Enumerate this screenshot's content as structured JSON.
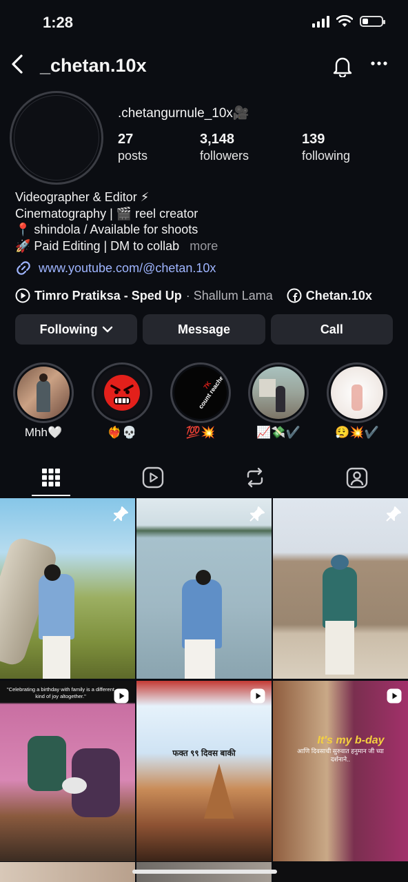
{
  "status": {
    "time": "1:28"
  },
  "header": {
    "username": "_chetan.10x"
  },
  "profile": {
    "handle": ".chetangurnule_10x🎥",
    "stats": [
      {
        "value": "27",
        "label": "posts"
      },
      {
        "value": "3,148",
        "label": "followers"
      },
      {
        "value": "139",
        "label": "following"
      }
    ],
    "bio": [
      "Videographer & Editor ⚡",
      "Cinematography | 🎬 reel creator",
      "📍 shindola / Available for shoots",
      "🚀 Paid Editing | DM to collab"
    ],
    "bio_more": "more",
    "link": "www.youtube.com/@chetan.10x",
    "music_title": "Timro Pratiksa - Sped Up",
    "music_artist": "· Shallum Lama",
    "facebook": "Chetan.10x"
  },
  "buttons": {
    "following": "Following",
    "message": "Message",
    "call": "Call"
  },
  "highlights": [
    {
      "caption": "Mhh🤍"
    },
    {
      "caption": "❤️‍🔥💀"
    },
    {
      "caption": "💯💥"
    },
    {
      "caption": "📈💸✔️"
    },
    {
      "caption": "😮‍💨💥✔️"
    }
  ],
  "highlight_texts": {
    "count_reached": "count reached",
    "seven_k": "7K"
  },
  "posts": {
    "p4_text": "\"Celebrating a birthday with family is a different kind of joy altogether.\"",
    "p5_text": "फक्त ९९ दिवस बाकी",
    "p6_title": "It's my b-day",
    "p6_text": "आणि दिवसाची सुरुवात हनुमान जी च्या दर्शनाने.."
  },
  "colors": {
    "background": "#0b0d12",
    "button": "#25272e",
    "link": "#9fb5ff"
  }
}
